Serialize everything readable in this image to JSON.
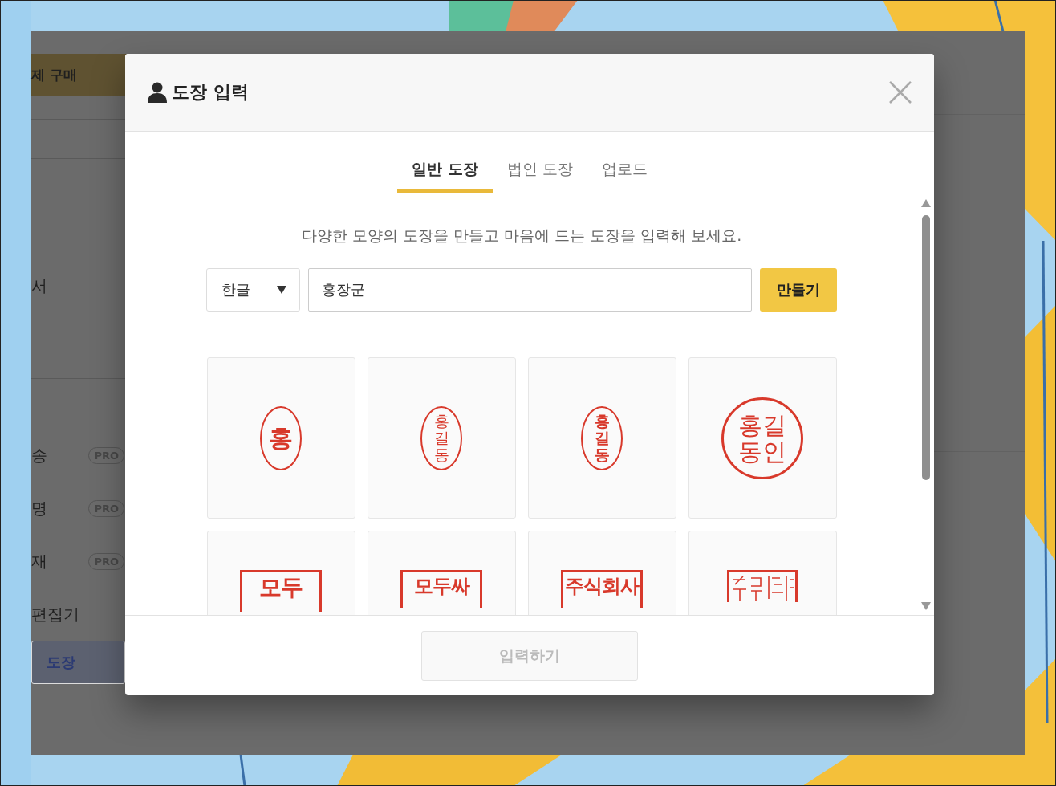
{
  "sidebar": {
    "items": [
      {
        "kind": "banner",
        "label": "제 구매"
      },
      {
        "kind": "divider"
      },
      {
        "kind": "divider"
      },
      {
        "kind": "item",
        "label": "서",
        "selected": false
      },
      {
        "kind": "divider"
      },
      {
        "kind": "item",
        "label": "송",
        "badge": "PRO",
        "selected": false
      },
      {
        "kind": "item",
        "label": "명",
        "badge": "PRO",
        "selected": false
      },
      {
        "kind": "item",
        "label": "재",
        "badge": "PRO",
        "selected": false
      },
      {
        "kind": "item",
        "label": "편집기",
        "selected": false
      },
      {
        "kind": "item",
        "label": "도장",
        "selected": true
      }
    ]
  },
  "dialog": {
    "title": "도장 입력",
    "tabs": [
      {
        "label": "일반 도장",
        "selected": true
      },
      {
        "label": "법인 도장",
        "selected": false
      },
      {
        "label": "업로드",
        "selected": false
      }
    ],
    "description": "다양한 모양의 도장을 만들고 마음에 드는 도장을 입력해 보세요.",
    "language_select": {
      "value": "한글"
    },
    "name_field": {
      "value": "홍장군"
    },
    "create_button": "만들기",
    "stamps": [
      {
        "kind": "oval",
        "text": "홍",
        "bold": true
      },
      {
        "kind": "oval",
        "text": "홍길동",
        "bold": false
      },
      {
        "kind": "oval",
        "text": "홍길동",
        "bold": true
      },
      {
        "kind": "circle",
        "text": "홍길동인",
        "bold": false
      },
      {
        "kind": "square",
        "text": "모두",
        "bold": true
      },
      {
        "kind": "square",
        "text": "모두싸",
        "bold": true
      },
      {
        "kind": "square",
        "text": "주식회사",
        "bold": true
      },
      {
        "kind": "square-seal"
      }
    ],
    "submit_button": {
      "label": "입력하기",
      "disabled": true
    }
  }
}
